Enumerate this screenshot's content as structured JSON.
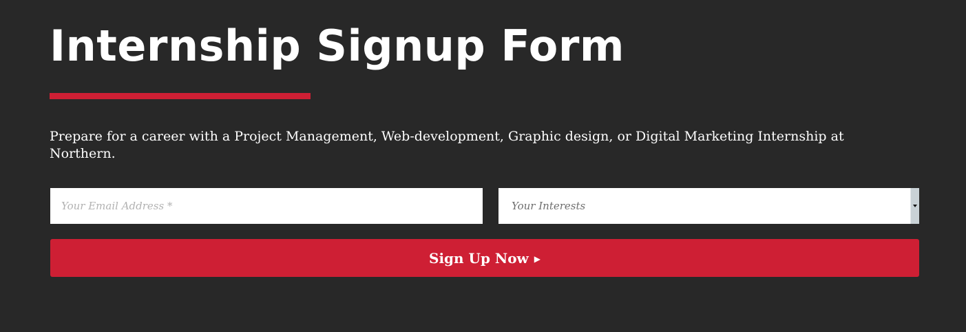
{
  "form": {
    "title": "Internship Signup Form",
    "description": "Prepare for a career with a Project Management, Web-development, Graphic design, or Digital Marketing Internship at Northern.",
    "email": {
      "placeholder": "Your Email Address *",
      "value": ""
    },
    "interests": {
      "selected": "Your Interests"
    },
    "submit": {
      "label": "Sign Up Now",
      "icon": "play-arrow-icon",
      "icon_glyph": "▶"
    }
  },
  "colors": {
    "background": "#282828",
    "accent": "#ce1f34",
    "text": "#ffffff",
    "field_background": "#ffffff",
    "placeholder": "#b2b2b2",
    "select_text": "#6e6e6e",
    "select_arrow_box": "#c9d2d6"
  }
}
